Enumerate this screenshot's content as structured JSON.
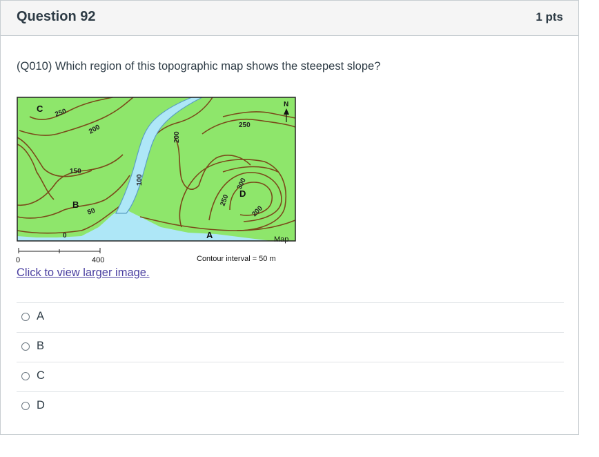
{
  "question": {
    "title": "Question 92",
    "points": "1 pts",
    "text": "(Q010) Which region of this topographic map shows the steepest slope?"
  },
  "map": {
    "region_labels": [
      "C",
      "B",
      "D",
      "A"
    ],
    "contour_labels": [
      "250",
      "200",
      "150",
      "50",
      "0",
      "100",
      "200",
      "250",
      "250",
      "300",
      "200"
    ],
    "north_label": "N",
    "map_label": "Map",
    "scale_start": "0",
    "scale_end": "400",
    "contour_interval": "Contour interval = 50 m",
    "colors": {
      "land": "#8ee66b",
      "water": "#aee7f7",
      "contour": "#7a4a1a",
      "river": "#5a9fc2"
    }
  },
  "link_text": "Click to view larger image.",
  "answers": [
    {
      "label": "A"
    },
    {
      "label": "B"
    },
    {
      "label": "C"
    },
    {
      "label": "D"
    }
  ]
}
